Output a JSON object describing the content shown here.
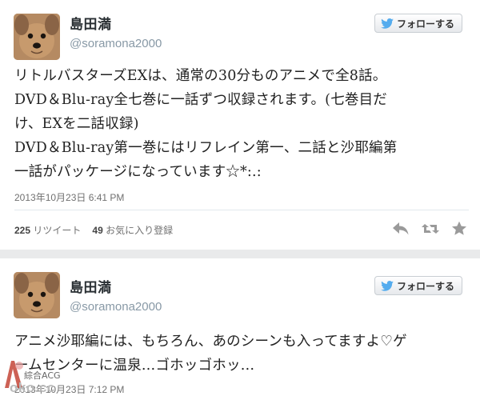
{
  "tweets": [
    {
      "user": {
        "name": "島田満",
        "handle": "@soramona2000"
      },
      "follow_label": "フォローする",
      "lines": [
        "リトルバスターズEXは、通常の30分ものアニメで全8話。",
        "DVD＆Blu-ray全七巻に一話ずつ収録されます。(七巻目だ",
        "け、EXを二話収録)",
        "DVD＆Blu-ray第一巻にはリフレイン第一、二話と沙耶編第",
        "一話がパッケージになっています☆*:.:"
      ],
      "timestamp": "2013年10月23日 6:41 PM",
      "retweets": {
        "count": "225",
        "label": "リツイート"
      },
      "favorites": {
        "count": "49",
        "label": "お気に入り登録"
      },
      "actions": [
        "reply-icon",
        "retweet-icon",
        "favorite-icon"
      ]
    },
    {
      "user": {
        "name": "島田満",
        "handle": "@soramona2000"
      },
      "follow_label": "フォローする",
      "lines": [
        "アニメ沙耶編には、もちろん、あのシーンも入ってますよ♡ゲ",
        "ームセンターに温泉…ゴホッゴホッ…"
      ],
      "timestamp": "2013年10月23日 7:12 PM"
    }
  ],
  "watermark": {
    "line1": "綜合ACG",
    "line2": "oko.cc"
  },
  "colors": {
    "twitter_blue": "#55acee",
    "name": "#292f33",
    "handle": "#8899a6",
    "background": "#e9eaeb"
  }
}
